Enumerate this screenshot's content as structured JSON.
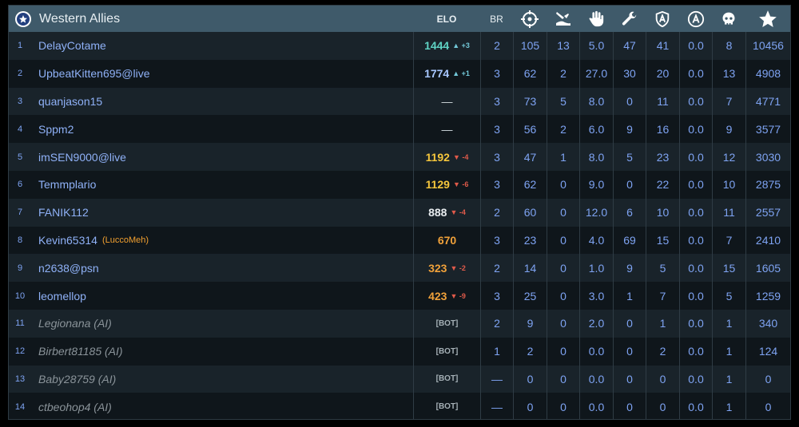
{
  "header": {
    "team_name": "Western Allies",
    "team_icon": "star-roundel-icon",
    "elo_label": "ELO",
    "br_label": "BR",
    "column_icons": [
      "crosshair-icon",
      "crashed-plane-icon",
      "hand-icon",
      "wrench-icon",
      "capture-shield-icon",
      "circled-a-icon",
      "skull-icon",
      "star-icon"
    ]
  },
  "colors": {
    "header_bg": "#3f5a6a",
    "name_blue": "#8fb1f7",
    "elo_teal": "#5fd3c4",
    "elo_blue": "#a8c8ff",
    "elo_yellow": "#f5c63c",
    "elo_white": "#e8ecef",
    "elo_orange": "#f0a13a",
    "delta_up": "#72c8d8",
    "delta_down": "#e05a4a",
    "ai_gray": "#8a9399"
  },
  "players": [
    {
      "rank": "1",
      "name": "DelayCotame",
      "sub": "",
      "ai": false,
      "elo": "1444",
      "elo_color": "#5fd3c4",
      "dir": "up",
      "delta": "+3",
      "br": "2",
      "v": [
        "105",
        "13",
        "5.0",
        "47",
        "41",
        "0.0",
        "8",
        "10456"
      ]
    },
    {
      "rank": "2",
      "name": "UpbeatKitten695@live",
      "sub": "",
      "ai": false,
      "elo": "1774",
      "elo_color": "#a8c8ff",
      "dir": "up",
      "delta": "+1",
      "br": "3",
      "v": [
        "62",
        "2",
        "27.0",
        "30",
        "20",
        "0.0",
        "13",
        "4908"
      ]
    },
    {
      "rank": "3",
      "name": "quanjason15",
      "sub": "",
      "ai": false,
      "elo": "—",
      "elo_color": "",
      "dir": "",
      "delta": "",
      "br": "3",
      "v": [
        "73",
        "5",
        "8.0",
        "0",
        "11",
        "0.0",
        "7",
        "4771"
      ]
    },
    {
      "rank": "4",
      "name": "Sppm2",
      "sub": "",
      "ai": false,
      "elo": "—",
      "elo_color": "",
      "dir": "",
      "delta": "",
      "br": "3",
      "v": [
        "56",
        "2",
        "6.0",
        "9",
        "16",
        "0.0",
        "9",
        "3577"
      ]
    },
    {
      "rank": "5",
      "name": "imSEN9000@live",
      "sub": "",
      "ai": false,
      "elo": "1192",
      "elo_color": "#f5c63c",
      "dir": "down",
      "delta": "-4",
      "br": "3",
      "v": [
        "47",
        "1",
        "8.0",
        "5",
        "23",
        "0.0",
        "12",
        "3030"
      ]
    },
    {
      "rank": "6",
      "name": "Temmplario",
      "sub": "",
      "ai": false,
      "elo": "1129",
      "elo_color": "#f5c63c",
      "dir": "down",
      "delta": "-6",
      "br": "3",
      "v": [
        "62",
        "0",
        "9.0",
        "0",
        "22",
        "0.0",
        "10",
        "2875"
      ]
    },
    {
      "rank": "7",
      "name": "FANIK112",
      "sub": "",
      "ai": false,
      "elo": "888",
      "elo_color": "#e8ecef",
      "dir": "down",
      "delta": "-4",
      "br": "2",
      "v": [
        "60",
        "0",
        "12.0",
        "6",
        "10",
        "0.0",
        "11",
        "2557"
      ]
    },
    {
      "rank": "8",
      "name": "Kevin65314",
      "sub": "(LuccoMeh)",
      "ai": false,
      "elo": "670",
      "elo_color": "#f0a13a",
      "dir": "",
      "delta": "",
      "br": "3",
      "v": [
        "23",
        "0",
        "4.0",
        "69",
        "15",
        "0.0",
        "7",
        "2410"
      ]
    },
    {
      "rank": "9",
      "name": "n2638@psn",
      "sub": "",
      "ai": false,
      "elo": "323",
      "elo_color": "#f0a13a",
      "dir": "down",
      "delta": "-2",
      "br": "2",
      "v": [
        "14",
        "0",
        "1.0",
        "9",
        "5",
        "0.0",
        "15",
        "1605"
      ]
    },
    {
      "rank": "10",
      "name": "leomellop",
      "sub": "",
      "ai": false,
      "elo": "423",
      "elo_color": "#f0a13a",
      "dir": "down",
      "delta": "-9",
      "br": "3",
      "v": [
        "25",
        "0",
        "3.0",
        "1",
        "7",
        "0.0",
        "5",
        "1259"
      ]
    },
    {
      "rank": "11",
      "name": "Legionana (AI)",
      "sub": "",
      "ai": true,
      "elo": "[BOT]",
      "elo_color": "",
      "dir": "",
      "delta": "",
      "br": "2",
      "v": [
        "9",
        "0",
        "2.0",
        "0",
        "1",
        "0.0",
        "1",
        "340"
      ]
    },
    {
      "rank": "12",
      "name": "Birbert81185 (AI)",
      "sub": "",
      "ai": true,
      "elo": "[BOT]",
      "elo_color": "",
      "dir": "",
      "delta": "",
      "br": "1",
      "v": [
        "2",
        "0",
        "0.0",
        "0",
        "2",
        "0.0",
        "1",
        "124"
      ]
    },
    {
      "rank": "13",
      "name": "Baby28759 (AI)",
      "sub": "",
      "ai": true,
      "elo": "[BOT]",
      "elo_color": "",
      "dir": "",
      "delta": "",
      "br": "—",
      "v": [
        "0",
        "0",
        "0.0",
        "0",
        "0",
        "0.0",
        "1",
        "0"
      ]
    },
    {
      "rank": "14",
      "name": "ctbeohop4 (AI)",
      "sub": "",
      "ai": true,
      "elo": "[BOT]",
      "elo_color": "",
      "dir": "",
      "delta": "",
      "br": "—",
      "v": [
        "0",
        "0",
        "0.0",
        "0",
        "0",
        "0.0",
        "1",
        "0"
      ]
    }
  ]
}
